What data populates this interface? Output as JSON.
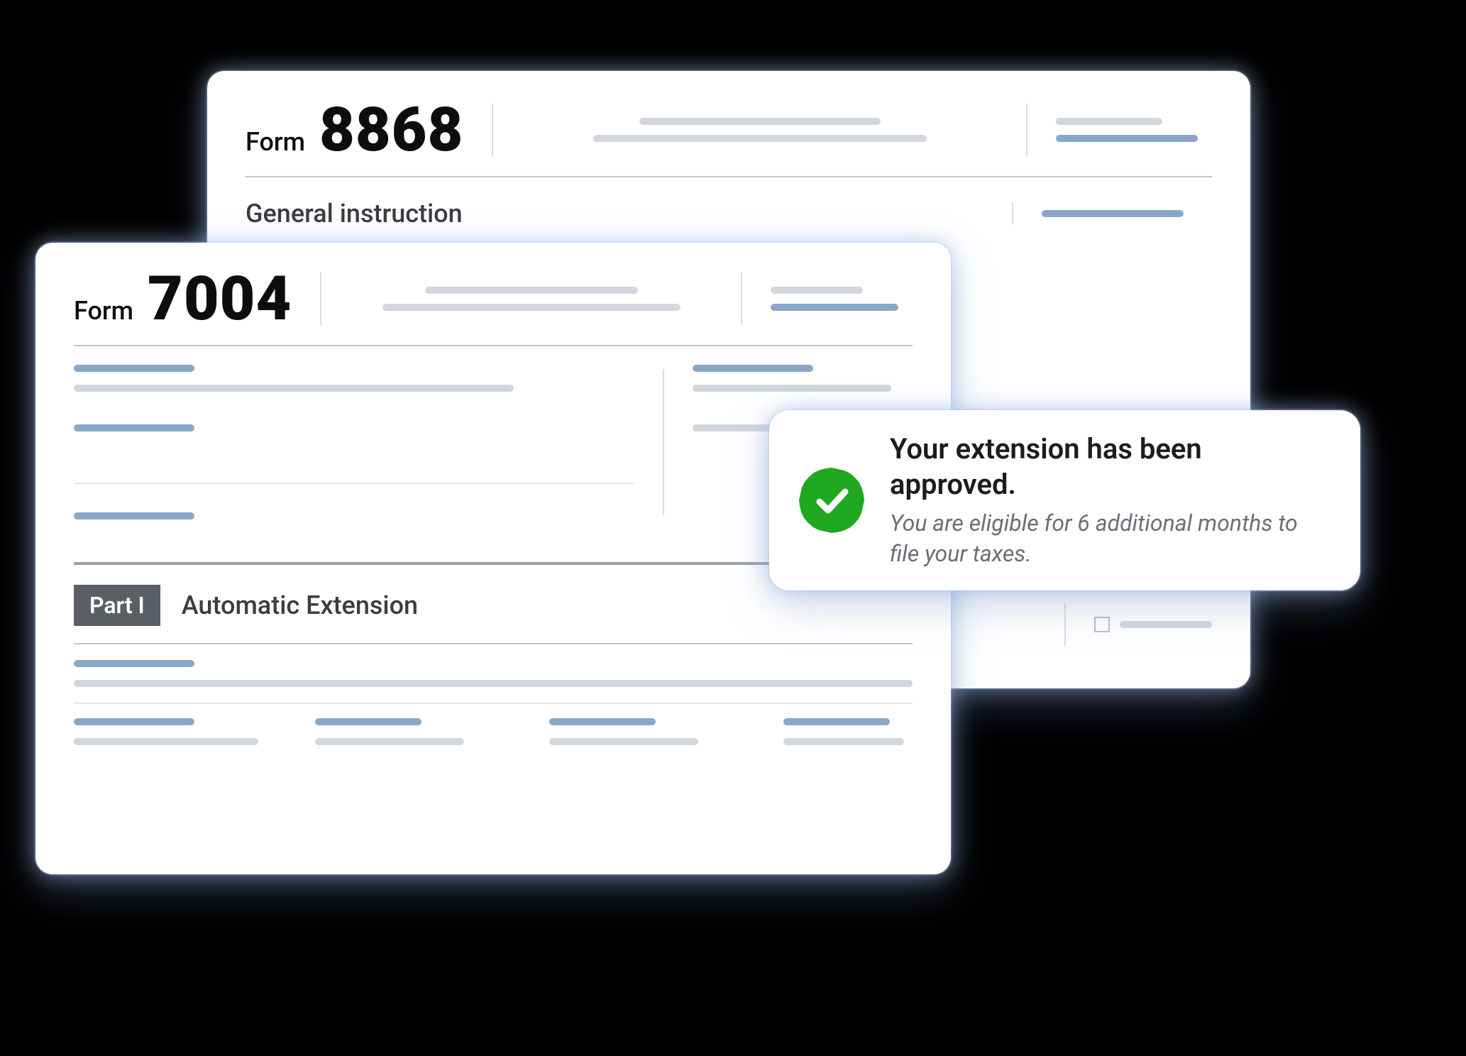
{
  "form8868": {
    "label": "Form",
    "number": "8868",
    "section_title": "General instruction"
  },
  "form7004": {
    "label": "Form",
    "number": "7004",
    "part_badge": "Part I",
    "part_title": "Automatic Extension"
  },
  "toast": {
    "title": "Your extension has been approved.",
    "subtitle": "You are eligible for 6 additional months to file your taxes."
  }
}
